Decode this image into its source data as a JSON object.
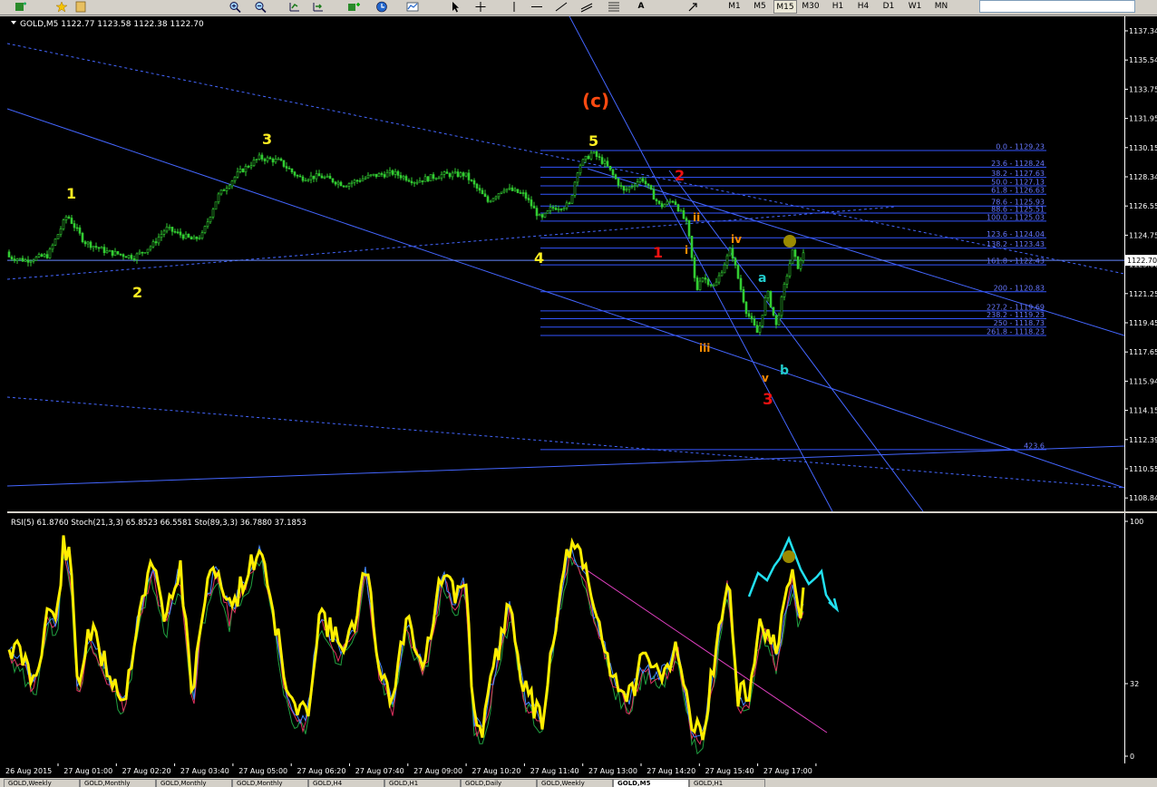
{
  "toolbar": {
    "timeframes": [
      "M1",
      "M5",
      "M15",
      "M30",
      "H1",
      "H4",
      "D1",
      "W1",
      "MN"
    ],
    "active_timeframe": "M15",
    "tool_letter": "A"
  },
  "chart": {
    "header": "GOLD,M5  1122.77 1123.58 1122.38 1122.70",
    "current_price": "1122.70",
    "price_ticks": [
      "1137.34",
      "1135.54",
      "1133.75",
      "1131.95",
      "1130.15",
      "1128.34",
      "1126.55",
      "1124.75",
      "1123.00",
      "1121.25",
      "1119.45",
      "1117.65",
      "1115.94",
      "1114.15",
      "1112.39",
      "1110.55",
      "1108.84"
    ],
    "fib_levels": [
      {
        "label": "0.0 - 1129.23",
        "price": 1129.23
      },
      {
        "label": "23.6 - 1128.24",
        "price": 1128.24
      },
      {
        "label": "38.2 - 1127.63",
        "price": 1127.63
      },
      {
        "label": "50.0 - 1127.13",
        "price": 1127.13
      },
      {
        "label": "61.8 - 1126.63",
        "price": 1126.63
      },
      {
        "label": "78.6 - 1125.93",
        "price": 1125.93
      },
      {
        "label": "88.6 - 1125.51",
        "price": 1125.51
      },
      {
        "label": "100.0 - 1125.03",
        "price": 1125.03
      },
      {
        "label": "123.6 - 1124.04",
        "price": 1124.04
      },
      {
        "label": "138.2 - 1123.43",
        "price": 1123.43
      },
      {
        "label": "161.8 - 1122.43",
        "price": 1122.43
      },
      {
        "label": "200 - 1120.83",
        "price": 1120.83
      },
      {
        "label": "227.2 - 1119.69",
        "price": 1119.69
      },
      {
        "label": "238.2 - 1119.23",
        "price": 1119.23
      },
      {
        "label": "250 - 1118.73",
        "price": 1118.73
      },
      {
        "label": "261.8 - 1118.23",
        "price": 1118.23
      },
      {
        "label": "423.6",
        "price": 1111.44
      }
    ],
    "wave_labels": {
      "w1": "1",
      "w2": "2",
      "w3": "3",
      "w4": "4",
      "w5": "5",
      "wc": "(c)",
      "r1": "1",
      "r2": "2",
      "r3": "3",
      "oi": "i",
      "oii": "ii",
      "oiii": "iii",
      "oiv": "iv",
      "ov": "v",
      "ta": "a",
      "tb": "b"
    },
    "colors": {
      "candle": "#32cd32",
      "fib": "#3355ff",
      "trend": "#4466ff",
      "wave_yellow": "#ffee22",
      "wave_red": "#ee1111",
      "wave_orange": "#ff8c00",
      "wave_teal": "#22cccc"
    }
  },
  "indicator": {
    "header": "RSI(5) 61.8760  Stoch(21,3,3) 65.8523 66.5581  Sto(89,3,3) 36.7880 37.1853",
    "ticks": [
      "100",
      "32",
      "0"
    ]
  },
  "time_axis": {
    "labels": [
      "26 Aug 2015",
      "27 Aug 01:00",
      "27 Aug 02:20",
      "27 Aug 03:40",
      "27 Aug 05:00",
      "27 Aug 06:20",
      "27 Aug 07:40",
      "27 Aug 09:00",
      "27 Aug 10:20",
      "27 Aug 11:40",
      "27 Aug 13:00",
      "27 Aug 14:20",
      "27 Aug 15:40",
      "27 Aug 17:00"
    ]
  },
  "tabs": [
    "GOLD,Weekly",
    "GOLD,Monthly",
    "GOLD,Monthly",
    "GOLD,Monthly",
    "GOLD,H4",
    "GOLD,H1",
    "GOLD,Daily",
    "GOLD,Weekly",
    "GOLD,M5",
    "GOLD,H1"
  ],
  "active_tab": "GOLD,M5"
}
